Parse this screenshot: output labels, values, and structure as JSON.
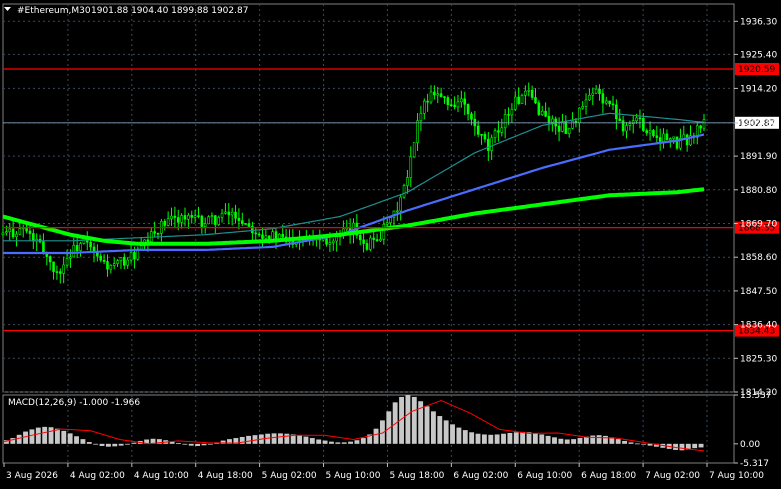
{
  "header": {
    "symbol_label": "#Ethereum,M30",
    "ohlc_text": "1901.88 1904.40 1899.88 1902.87",
    "menu_icon": "triangle-down-icon"
  },
  "colors": {
    "background": "#000000",
    "grid": "#3a4a5a",
    "candle": "#00ff00",
    "level_line": "#ff0000",
    "ma_fast": "#1f8f8f",
    "ma_mid": "#4a6cff",
    "ma_slow": "#00ff00",
    "macd_hist": "#c8c8c8",
    "macd_signal": "#ff0000",
    "bid_line": "#7f9fbf",
    "price_tag_bg": "#ffffff",
    "level_tag_bg": "#ff0000"
  },
  "chart_data": [
    {
      "type": "candlestick",
      "timeframe": "M30",
      "ylim": [
        1814.2,
        1942.0
      ],
      "y_ticks": [
        "1936.30",
        "1925.40",
        "1914.20",
        "1902.80",
        "1891.90",
        "1880.80",
        "1869.70",
        "1858.60",
        "1847.50",
        "1836.40",
        "1825.30",
        "1814.20"
      ],
      "x_ticks": [
        "3 Aug 2026",
        "4 Aug 02:00",
        "4 Aug 10:00",
        "4 Aug 18:00",
        "5 Aug 02:00",
        "5 Aug 10:00",
        "5 Aug 18:00",
        "6 Aug 02:00",
        "6 Aug 10:00",
        "6 Aug 18:00",
        "7 Aug 02:00",
        "7 Aug 10:00"
      ],
      "current_price": "1902.87",
      "horizontal_levels": [
        {
          "label": "1920.59",
          "value": 1920.59
        },
        {
          "label": "1868.35",
          "value": 1868.35
        },
        {
          "label": "1834.43",
          "value": 1834.43
        }
      ],
      "close_path": [
        [
          0,
          1866
        ],
        [
          6,
          1868
        ],
        [
          12,
          1861
        ],
        [
          16,
          1853
        ],
        [
          20,
          1860
        ],
        [
          24,
          1864
        ],
        [
          28,
          1858
        ],
        [
          32,
          1855
        ],
        [
          40,
          1860
        ],
        [
          46,
          1868
        ],
        [
          52,
          1872
        ],
        [
          60,
          1870
        ],
        [
          68,
          1873
        ],
        [
          76,
          1867
        ],
        [
          84,
          1864
        ],
        [
          92,
          1866
        ],
        [
          98,
          1864
        ],
        [
          104,
          1868
        ],
        [
          108,
          1863
        ],
        [
          112,
          1866
        ],
        [
          116,
          1872
        ],
        [
          120,
          1884
        ],
        [
          124,
          1908
        ],
        [
          128,
          1914
        ],
        [
          132,
          1909
        ],
        [
          136,
          1910
        ],
        [
          140,
          1901
        ],
        [
          144,
          1894
        ],
        [
          148,
          1903
        ],
        [
          152,
          1910
        ],
        [
          156,
          1912
        ],
        [
          160,
          1906
        ],
        [
          164,
          1902
        ],
        [
          168,
          1901
        ],
        [
          172,
          1908
        ],
        [
          176,
          1913
        ],
        [
          180,
          1909
        ],
        [
          184,
          1902
        ],
        [
          188,
          1904
        ],
        [
          192,
          1900
        ],
        [
          196,
          1898
        ],
        [
          200,
          1896
        ],
        [
          204,
          1898
        ],
        [
          208,
          1902.87
        ]
      ],
      "moving_averages": [
        {
          "path": [
            [
              0,
              1864
            ],
            [
              20,
              1864
            ],
            [
              40,
              1865
            ],
            [
              60,
              1866
            ],
            [
              80,
              1868
            ],
            [
              100,
              1872
            ],
            [
              120,
              1880
            ],
            [
              140,
              1893
            ],
            [
              160,
              1902
            ],
            [
              180,
              1906
            ],
            [
              200,
              1904
            ],
            [
              208,
              1903
            ]
          ]
        },
        {
          "path": [
            [
              0,
              1860
            ],
            [
              20,
              1860
            ],
            [
              40,
              1861
            ],
            [
              60,
              1861
            ],
            [
              80,
              1862
            ],
            [
              100,
              1866
            ],
            [
              120,
              1874
            ],
            [
              140,
              1881
            ],
            [
              160,
              1888
            ],
            [
              180,
              1894
            ],
            [
              200,
              1897
            ],
            [
              208,
              1899
            ]
          ]
        },
        {
          "path": [
            [
              0,
              1872
            ],
            [
              10,
              1869
            ],
            [
              20,
              1866
            ],
            [
              30,
              1864
            ],
            [
              40,
              1863
            ],
            [
              60,
              1863
            ],
            [
              80,
              1864
            ],
            [
              100,
              1866
            ],
            [
              120,
              1869
            ],
            [
              140,
              1873
            ],
            [
              160,
              1876
            ],
            [
              180,
              1879
            ],
            [
              200,
              1880
            ],
            [
              208,
              1881
            ]
          ]
        }
      ]
    },
    {
      "type": "bar",
      "indicator_label": "MACD(12,26,9) -1.000 -1.966",
      "ylim": [
        -5.317,
        13.537
      ],
      "y_ticks": [
        "13.537",
        "0.00",
        "-5.317"
      ],
      "histogram": [
        1.0,
        1.6,
        2.5,
        3.4,
        4.0,
        4.5,
        4.7,
        4.6,
        4.2,
        3.6,
        2.9,
        2.1,
        1.3,
        0.5,
        -0.2,
        -0.6,
        -0.8,
        -0.7,
        -0.5,
        -0.2,
        0.3,
        0.8,
        1.2,
        1.4,
        1.3,
        1.0,
        0.6,
        0.2,
        -0.2,
        -0.5,
        -0.6,
        -0.4,
        0.0,
        0.4,
        0.9,
        1.3,
        1.6,
        1.9,
        2.2,
        2.4,
        2.6,
        2.8,
        2.9,
        2.9,
        2.8,
        2.6,
        2.3,
        2.0,
        1.6,
        1.2,
        0.9,
        0.6,
        0.4,
        0.4,
        0.6,
        1.0,
        1.6,
        2.6,
        4.2,
        6.5,
        9.0,
        11.5,
        13.0,
        13.5,
        13.0,
        11.8,
        10.4,
        9.0,
        7.7,
        6.5,
        5.4,
        4.5,
        3.8,
        3.2,
        2.8,
        2.6,
        2.5,
        2.6,
        2.8,
        3.0,
        3.2,
        3.3,
        3.2,
        3.0,
        2.6,
        2.2,
        1.8,
        1.4,
        1.2,
        1.3,
        1.6,
        2.0,
        2.3,
        2.4,
        2.2,
        1.8,
        1.3,
        0.8,
        0.4,
        0.1,
        -0.2,
        -0.5,
        -0.8,
        -1.1,
        -1.4,
        -1.7,
        -1.8,
        -1.6,
        -1.2,
        -1.0
      ],
      "signal": [
        [
          0,
          0.5
        ],
        [
          10,
          2.4
        ],
        [
          20,
          4.1
        ],
        [
          30,
          3.6
        ],
        [
          40,
          1.2
        ],
        [
          50,
          0.0
        ],
        [
          60,
          0.8
        ],
        [
          70,
          0.3
        ],
        [
          80,
          0.2
        ],
        [
          90,
          1.5
        ],
        [
          100,
          2.4
        ],
        [
          110,
          2.4
        ],
        [
          120,
          1.2
        ],
        [
          130,
          3.0
        ],
        [
          140,
          9.0
        ],
        [
          150,
          12.0
        ],
        [
          160,
          8.5
        ],
        [
          170,
          4.0
        ],
        [
          180,
          2.9
        ],
        [
          190,
          3.0
        ],
        [
          200,
          1.8
        ],
        [
          210,
          1.6
        ],
        [
          220,
          0.3
        ],
        [
          230,
          -1.0
        ],
        [
          240,
          -1.966
        ]
      ]
    }
  ]
}
